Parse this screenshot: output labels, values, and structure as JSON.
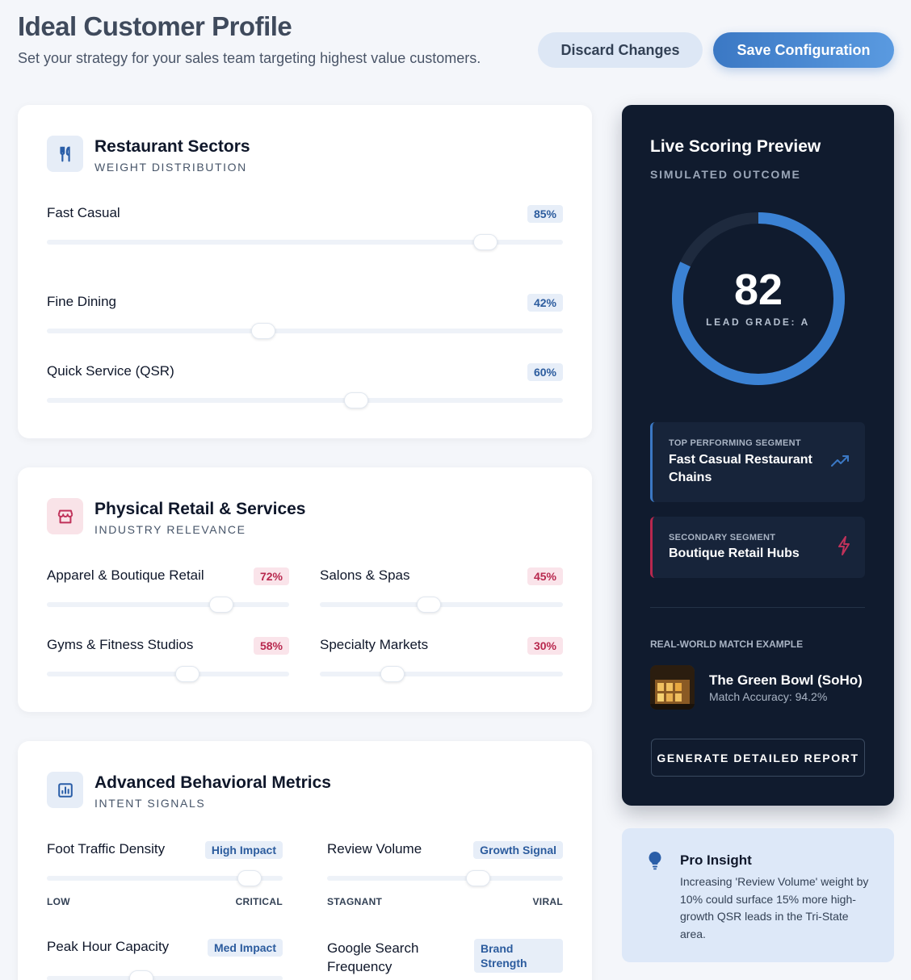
{
  "header": {
    "title": "Ideal Customer Profile",
    "subtitle": "Set your strategy for your sales team targeting highest value customers.",
    "discard_label": "Discard Changes",
    "save_label": "Save Configuration"
  },
  "restaurant": {
    "title": "Restaurant Sectors",
    "subtitle": "WEIGHT DISTRIBUTION",
    "icon": "utensils-icon",
    "sliders": [
      {
        "label": "Fast Casual",
        "value": 85,
        "badge": "85%"
      },
      {
        "label": "Fine Dining",
        "value": 42,
        "badge": "42%"
      },
      {
        "label": "Quick Service (QSR)",
        "value": 60,
        "badge": "60%"
      }
    ]
  },
  "retail": {
    "title": "Physical Retail & Services",
    "subtitle": "INDUSTRY RELEVANCE",
    "icon": "storefront-icon",
    "sliders": [
      {
        "label": "Apparel & Boutique Retail",
        "value": 72,
        "badge": "72%"
      },
      {
        "label": "Salons & Spas",
        "value": 45,
        "badge": "45%"
      },
      {
        "label": "Gyms & Fitness Studios",
        "value": 58,
        "badge": "58%"
      },
      {
        "label": "Specialty Markets",
        "value": 30,
        "badge": "30%"
      }
    ]
  },
  "behavioral": {
    "title": "Advanced Behavioral Metrics",
    "subtitle": "INTENT SIGNALS",
    "icon": "bar-chart-icon",
    "sliders": [
      {
        "label": "Foot Traffic Density",
        "value": 86,
        "badge": "High Impact",
        "low": "LOW",
        "high": "CRITICAL"
      },
      {
        "label": "Review Volume",
        "value": 64,
        "badge": "Growth Signal",
        "low": "STAGNANT",
        "high": "VIRAL"
      },
      {
        "label": "Peak Hour Capacity",
        "value": 40,
        "badge": "Med Impact"
      },
      {
        "label": "Google Search Frequency",
        "badge": "Brand Strength"
      }
    ]
  },
  "preview": {
    "title": "Live Scoring Preview",
    "subtitle": "SIMULATED OUTCOME",
    "score": "82",
    "score_fraction": 0.82,
    "grade": "LEAD GRADE: A",
    "top_kicker": "TOP PERFORMING SEGMENT",
    "top_name": "Fast Casual Restaurant Chains",
    "sec_kicker": "SECONDARY SEGMENT",
    "sec_name": "Boutique Retail Hubs",
    "rw_label": "REAL-WORLD MATCH EXAMPLE",
    "rw_name": "The Green Bowl (SoHo)",
    "rw_accuracy": "Match Accuracy: 94.2%",
    "report_label": "GENERATE DETAILED REPORT",
    "colors": {
      "accent": "#3b82d4",
      "secondary": "#b8284e",
      "panel": "#101b2e"
    }
  },
  "insight": {
    "title": "Pro Insight",
    "body": "Increasing 'Review Volume' weight by 10% could surface 15% more high-growth QSR leads in the Tri-State area."
  }
}
